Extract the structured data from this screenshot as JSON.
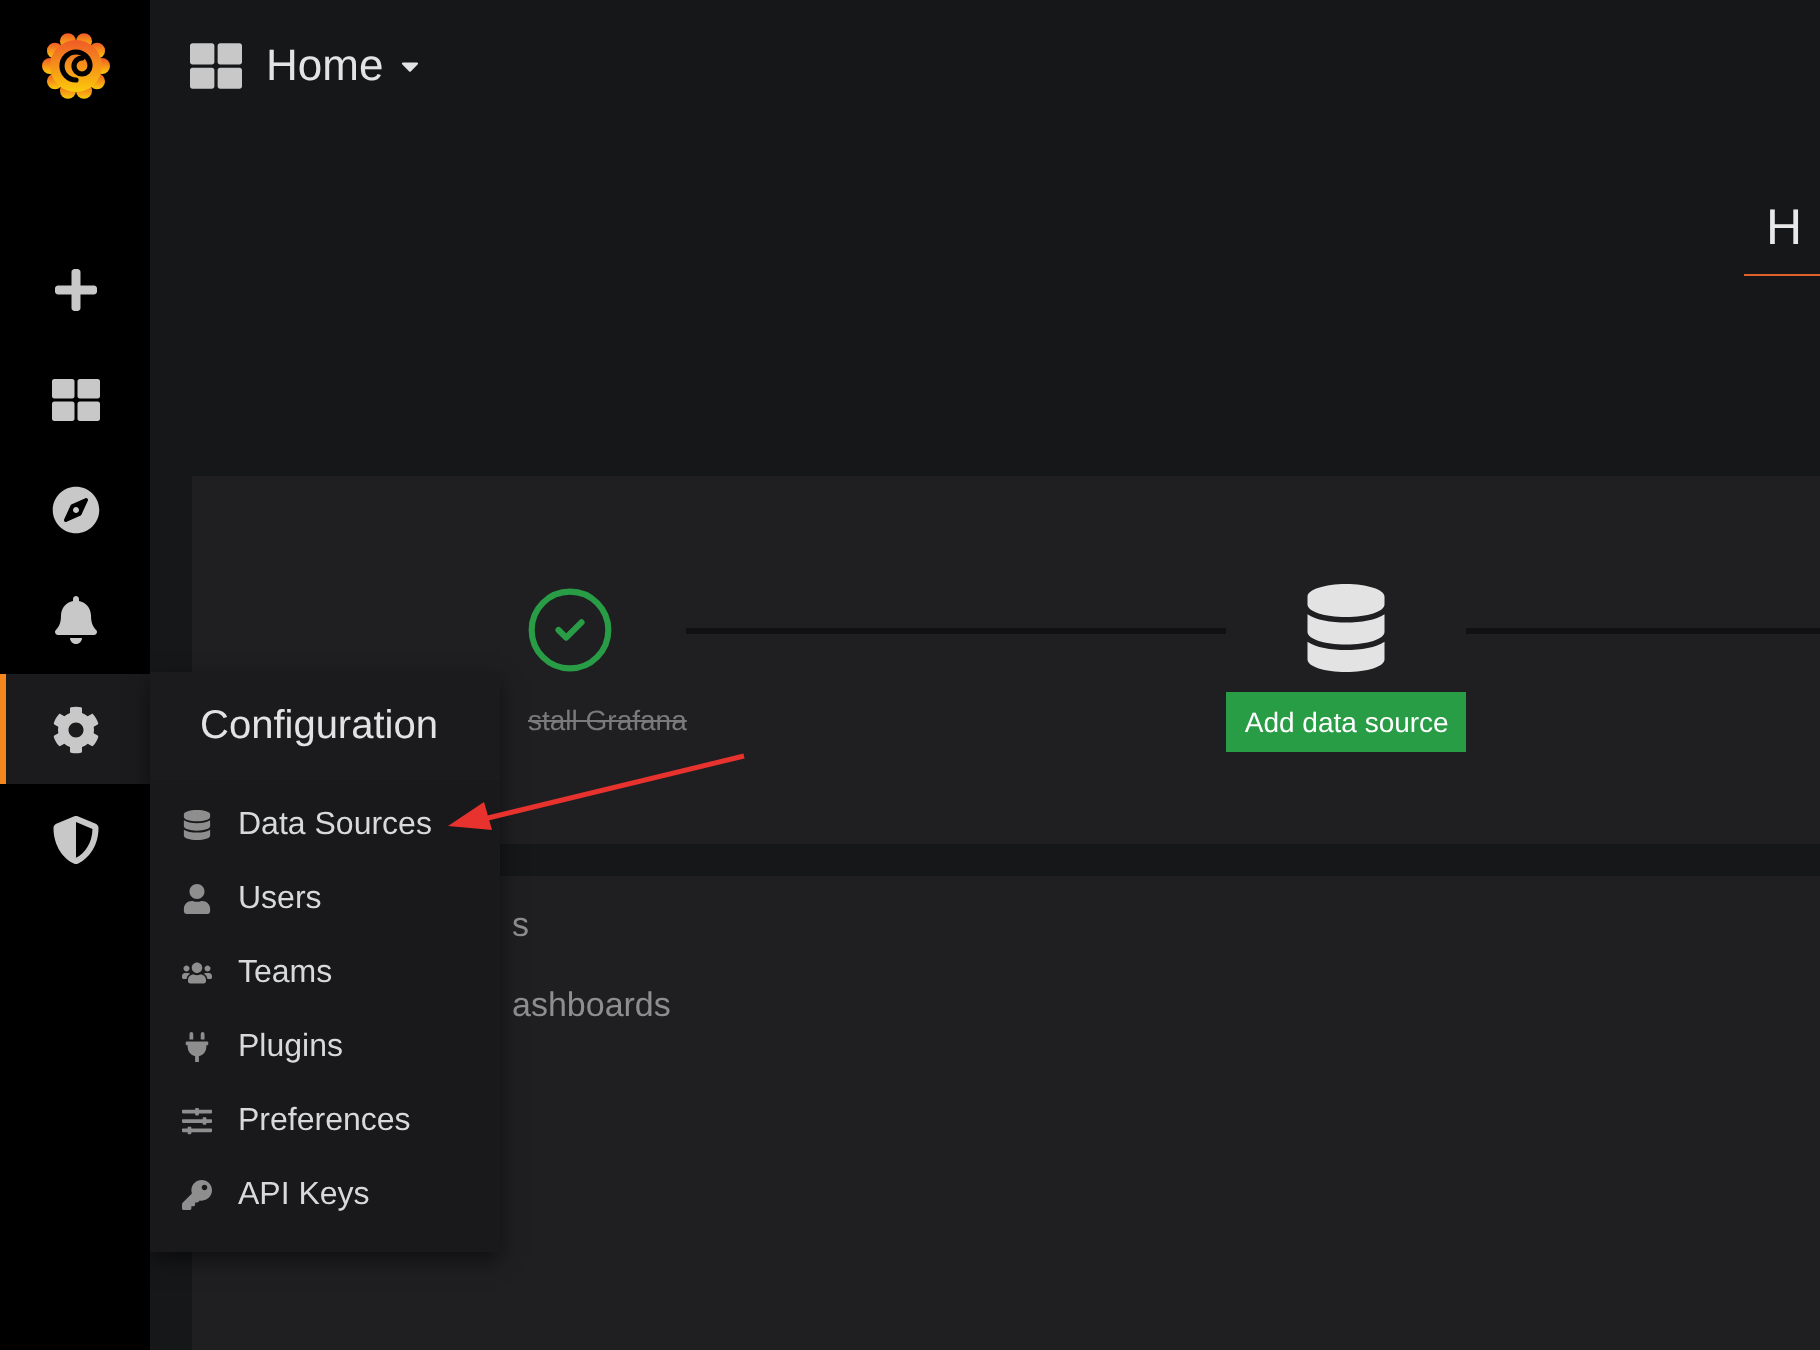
{
  "topbar": {
    "title": "Home"
  },
  "sidebar": {
    "items": [
      {
        "kind": "create",
        "selected": false
      },
      {
        "kind": "dashboards",
        "selected": false
      },
      {
        "kind": "explore",
        "selected": false
      },
      {
        "kind": "alerting",
        "selected": false
      },
      {
        "kind": "configuration",
        "selected": true
      },
      {
        "kind": "admin",
        "selected": false
      }
    ]
  },
  "page_header": {
    "title": "H"
  },
  "steps": [
    {
      "kind": "done",
      "label": "stall Grafana"
    },
    {
      "kind": "database",
      "button": "Add data source"
    }
  ],
  "list_panel": {
    "items": [
      "s",
      "ashboards"
    ]
  },
  "menu": {
    "title": "Configuration",
    "items": [
      {
        "kind": "database",
        "label": "Data Sources"
      },
      {
        "kind": "user",
        "label": "Users"
      },
      {
        "kind": "users",
        "label": "Teams"
      },
      {
        "kind": "plug",
        "label": "Plugins"
      },
      {
        "kind": "sliders",
        "label": "Preferences"
      },
      {
        "kind": "key",
        "label": "API Keys"
      }
    ]
  }
}
